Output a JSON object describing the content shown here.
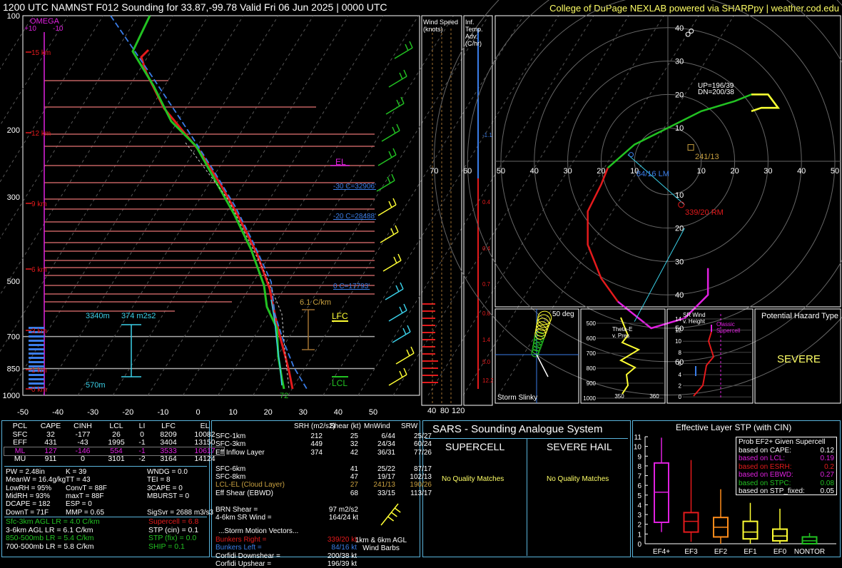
{
  "header": {
    "title": "1200 UTC NAMNST F012 Sounding for 33.87,-99.78 Valid  Fri 06 Jun 2025 | 0000 UTC",
    "credit": "College of DuPage NEXLAB powered via SHARPpy | weather.cod.edu"
  },
  "skewt": {
    "pressure_ticks": [
      "100",
      "200",
      "300",
      "500",
      "700",
      "850",
      "1000"
    ],
    "temp_ticks": [
      "-50",
      "-40",
      "-30",
      "-20",
      "-10",
      "0",
      "10",
      "20",
      "30",
      "40",
      "50"
    ],
    "omega_label": "OMEGA",
    "omega_ticks": [
      "+10",
      "-10"
    ],
    "height_labels": [
      "15 km",
      "12 km",
      "9 km",
      "6 km",
      "3 km",
      "1 km",
      "0 km"
    ],
    "annotations": {
      "el": "EL",
      "lfc": "LFC",
      "lcl": "LCL",
      "m30": "-30 C=32906'",
      "m20": "-20 C=28488'",
      "zero": "0 C=17793'",
      "lapse": "6.1 C/km",
      "eff_top": "3340m",
      "eff_srh": "374 m2s2",
      "eff_bot": "570m",
      "sfc_temp": "72"
    },
    "colors": {
      "temp": "#e41a1c",
      "dew": "#22c222",
      "virtual": "#3a7de8",
      "wetbulb": "#3ad0e8"
    }
  },
  "wind_speed_panel": {
    "title": "Wind Speed (knots)",
    "ticks": [
      "40",
      "80",
      "120"
    ]
  },
  "temp_adv_panel": {
    "title": "Inf. Temp. Adv. (C/hr)",
    "values": [
      "-1.1",
      "0.4",
      "0.4",
      "0.7",
      "0.8",
      "1.4",
      "5.0",
      "12.2"
    ]
  },
  "hodograph": {
    "rings": [
      "10",
      "20",
      "30",
      "40",
      "50",
      "60"
    ],
    "axis_labels": [
      "70",
      "60",
      "50",
      "40",
      "30",
      "20",
      "10",
      "0",
      "10",
      "20",
      "30",
      "40",
      "50",
      "60",
      "70"
    ],
    "up_dn": "UP=196/39",
    "dn": "DN=200/38",
    "lm": "84/16 LM",
    "rm": "339/20 RM",
    "mean": "241/13",
    "trace": [
      [
        -18,
        -2
      ],
      [
        -10,
        5
      ],
      [
        0,
        10
      ],
      [
        10,
        15
      ],
      [
        20,
        18
      ],
      [
        25,
        20
      ],
      [
        30,
        20
      ],
      [
        33,
        16
      ],
      [
        28,
        16
      ],
      [
        25,
        15
      ]
    ],
    "trace_red": [
      [
        -20,
        -7
      ],
      [
        -24,
        -15
      ],
      [
        -24,
        -25
      ],
      [
        -20,
        -35
      ],
      [
        -15,
        -42
      ]
    ],
    "trace_magenta": [
      [
        -15,
        -42
      ],
      [
        -5,
        -50
      ],
      [
        5,
        -47
      ],
      [
        12,
        -40
      ],
      [
        12,
        -32
      ]
    ]
  },
  "storm_slinky": {
    "title": "Storm Slinky",
    "deg": "50 deg"
  },
  "theta_e": {
    "title": "Theta-E v. Pres",
    "pres_ticks": [
      "500",
      "600",
      "700",
      "800",
      "900",
      "1000"
    ],
    "x_ticks": [
      "350",
      "360"
    ]
  },
  "sr_wind": {
    "title": "SR Wind v. Height",
    "note": "Classic Supercell",
    "ticks": [
      "14",
      "12",
      "10",
      "8",
      "6",
      "4",
      "2",
      "0"
    ]
  },
  "hazard": {
    "title": "Potential Hazard Type",
    "value": "SEVERE"
  },
  "parcels": {
    "headers": [
      "PCL",
      "CAPE",
      "CINH",
      "LCL",
      "LI",
      "LFC",
      "EL"
    ],
    "rows": [
      [
        "SFC",
        "32",
        "-177",
        "26",
        "0",
        "8209",
        "10082"
      ],
      [
        "EFF",
        "431",
        "-43",
        "1995",
        "-1",
        "3404",
        "13150"
      ],
      [
        "ML",
        "127",
        "-146",
        "554",
        "-1",
        "3533",
        "10617"
      ],
      [
        "MU",
        "911",
        "0",
        "3101",
        "-2",
        "3164",
        "14124"
      ]
    ]
  },
  "indices": {
    "col1": [
      "PW = 2.48in",
      "MeanW = 16.4g/kg",
      "LowRH = 95%",
      "MidRH = 93%",
      "DCAPE = 182",
      "DownT = 71F"
    ],
    "col2": [
      "K = 39",
      "TT = 43",
      "ConvT = 88F",
      "maxT = 88F",
      "ESP = 0",
      "MMP = 0.65"
    ],
    "col3": [
      "WNDG = 0.0",
      "TEI = 8",
      "3CAPE = 0",
      "MBURST = 0",
      "",
      "SigSvr = 2688 m3/s3"
    ]
  },
  "lapse_rates": [
    {
      "label": "Sfc-3km AGL LR = 4.0 C/km",
      "color": "#22c222"
    },
    {
      "label": "3-6km AGL LR = 6.1 C/km",
      "color": "#ffffff"
    },
    {
      "label": "850-500mb LR = 5.4 C/km",
      "color": "#22c222"
    },
    {
      "label": "700-500mb LR = 5.8 C/km",
      "color": "#ffffff"
    }
  ],
  "composites": [
    {
      "label": "Supercell = 6.8",
      "color": "#e41a1c"
    },
    {
      "label": "STP (cin) = 0.1",
      "color": "#ffffff"
    },
    {
      "label": "STP (fix) = 0.0",
      "color": "#22c222"
    },
    {
      "label": "SHIP = 0.1",
      "color": "#22c222"
    }
  ],
  "kinematics": {
    "headers": [
      "SRH (m2/s2)",
      "Shear (kt)",
      "MnWind",
      "SRW"
    ],
    "rows": [
      [
        "SFC-1km",
        "212",
        "25",
        "6/44",
        "25/27"
      ],
      [
        "SFC-3km",
        "449",
        "32",
        "24/34",
        "60/24"
      ],
      [
        "Eff Inflow Layer",
        "374",
        "42",
        "36/31",
        "77/26"
      ],
      [
        "",
        "",
        "",
        "",
        ""
      ],
      [
        "SFC-6km",
        "",
        "41",
        "25/22",
        "87/17"
      ],
      [
        "SFC-8km",
        "",
        "47",
        "19/17",
        "102/13"
      ],
      [
        "LCL-EL (Cloud Layer)",
        "",
        "27",
        "241/13",
        "190/26"
      ],
      [
        "Eff Shear (EBWD)",
        "",
        "68",
        "33/15",
        "113/17"
      ]
    ],
    "brn": [
      "BRN Shear =",
      "97 m2/s2"
    ],
    "srw46": [
      "4-6km SR Wind =",
      "164/24 kt"
    ],
    "motion_title": "...Storm Motion Vectors...",
    "motion": [
      [
        "Bunkers Right =",
        "339/20 kt",
        "#e41a1c"
      ],
      [
        "Bunkers Left =",
        "84/16 kt",
        "#3a7de8"
      ],
      [
        "Corfidi Downshear =",
        "200/38 kt",
        "#ffffff"
      ],
      [
        "Corfidi Upshear =",
        "196/39 kt",
        "#ffffff"
      ]
    ],
    "barb_label": "1km & 6km AGL Wind Barbs"
  },
  "sars": {
    "title": "SARS - Sounding Analogue System",
    "supercell": "SUPERCELL",
    "hail": "SEVERE HAIL",
    "sup_match": "No Quality Matches",
    "hail_match": "No Quality Matches"
  },
  "stp_panel": {
    "title": "Effective Layer STP (with CIN)",
    "y_ticks": [
      "11",
      "10",
      "9",
      "8",
      "7",
      "6",
      "5",
      "4",
      "3",
      "2",
      "1",
      "0"
    ],
    "legend_title": "Prob EF2+ Given Supercell",
    "legend": [
      [
        "based on CAPE:",
        "0.12",
        "#ffffff"
      ],
      [
        "based on LCL:",
        "0.19",
        "#e020e0"
      ],
      [
        "based on ESRH:",
        "0.2",
        "#e41a1c"
      ],
      [
        "based on EBWD:",
        "0.27",
        "#e020e0"
      ],
      [
        "based on STPC:",
        "0.08",
        "#22c222"
      ],
      [
        "based on STP_fixed:",
        "0.05",
        "#ffffff"
      ]
    ]
  },
  "chart_data": {
    "type": "box",
    "title": "Effective Layer STP (with CIN)",
    "categories": [
      "EF4+",
      "EF3",
      "EF2",
      "EF1",
      "EF0",
      "NONTOR"
    ],
    "colors": [
      "#e020e0",
      "#e41a1c",
      "#ff8c1a",
      "#ffff33",
      "#ffff33",
      "#22c222"
    ],
    "whisker_low": [
      1.2,
      0.2,
      0.0,
      0.0,
      0.0,
      0.0
    ],
    "q1": [
      2.2,
      1.2,
      0.7,
      0.5,
      0.3,
      0.0
    ],
    "median": [
      5.3,
      2.3,
      1.7,
      1.2,
      0.8,
      0.3
    ],
    "q3": [
      8.3,
      3.2,
      2.7,
      2.3,
      1.5,
      0.7
    ],
    "whisker_high": [
      10.9,
      8.6,
      5.6,
      4.2,
      3.6,
      1.1
    ],
    "ylim": [
      0,
      11
    ]
  }
}
